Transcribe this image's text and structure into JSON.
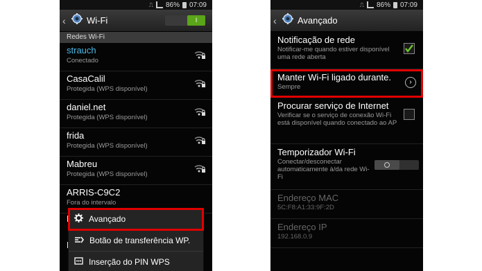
{
  "status_bar": {
    "battery": "86%",
    "time": "07:09"
  },
  "left_screen": {
    "title": "Wi-Fi",
    "toggle_label": "I",
    "section_header": "Redes Wi-Fi",
    "networks": [
      {
        "name": "strauch",
        "status": "Conectado",
        "connected": true
      },
      {
        "name": "CasaCalil",
        "status": "Protegida (WPS disponível)"
      },
      {
        "name": "daniel.net",
        "status": "Protegida (WPS disponível)"
      },
      {
        "name": "frida",
        "status": "Protegida (WPS disponível)"
      },
      {
        "name": "Mabreu",
        "status": "Protegida (WPS disponível)"
      },
      {
        "name": "ARRIS-C9C2",
        "status": "Fora do intervalo"
      }
    ],
    "partial_letters": [
      "D",
      "L"
    ],
    "menu": [
      {
        "label": "Avançado",
        "icon": "gear-icon"
      },
      {
        "label": "Botão de transferência WP.",
        "icon": "wps-icon"
      },
      {
        "label": "Inserção do PIN WPS",
        "icon": "pin-icon"
      }
    ]
  },
  "right_screen": {
    "title": "Avançado",
    "settings": [
      {
        "title": "Notificação de rede",
        "subtitle": "Notificar-me quando estiver disponível uma rede aberta",
        "control": "checkbox-checked"
      },
      {
        "title": "Manter Wi-Fi ligado durante.",
        "subtitle": "Sempre",
        "control": "arrow"
      },
      {
        "title": "Procurar serviço de Internet",
        "subtitle": "Verificar se o serviço de conexão Wi-Fi está disponível quando conectado ao AP",
        "control": "checkbox"
      },
      {
        "title": "Temporizador Wi-Fi",
        "subtitle": "Conectar/desconectar automaticamente à/da rede Wi-Fi",
        "control": "toggle-off"
      },
      {
        "title": "Endereço MAC",
        "subtitle": "5C:F8:A1:33:9F:2D",
        "disabled": true
      },
      {
        "title": "Endereço IP",
        "subtitle": "192.168.0.9",
        "disabled": true
      }
    ]
  },
  "colors": {
    "highlight": "#e10000",
    "connected": "#4cb8e6",
    "toggle_on": "#5aa519",
    "check": "#6ec32a"
  }
}
